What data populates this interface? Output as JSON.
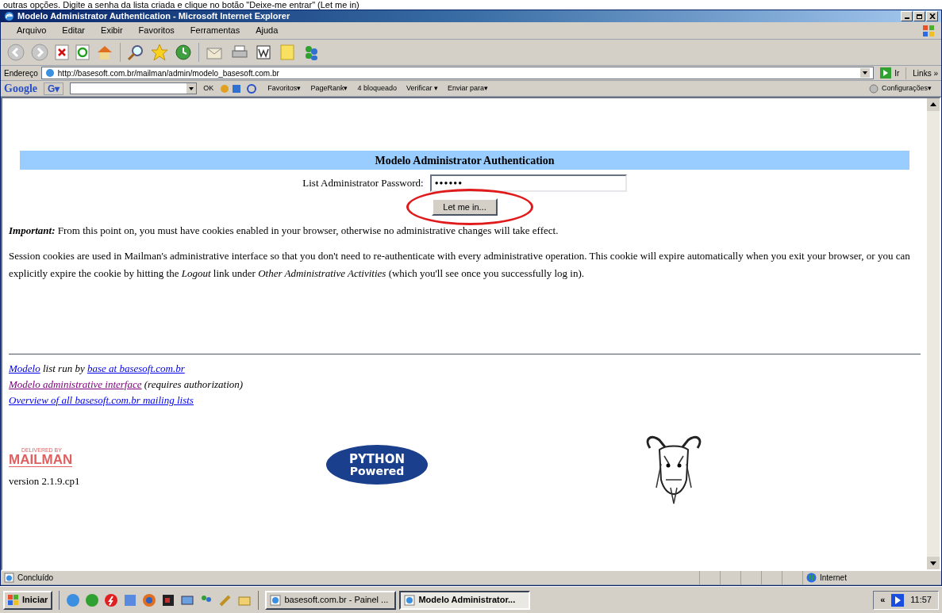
{
  "caption": "outras opções. Digite a senha da lista criada e clique no botão \"Deixe-me entrar\" (Let me in)",
  "window": {
    "title": "Modelo Administrator Authentication - Microsoft Internet Explorer"
  },
  "menu": [
    "Arquivo",
    "Editar",
    "Exibir",
    "Favoritos",
    "Ferramentas",
    "Ajuda"
  ],
  "address_bar": {
    "label": "Endereço",
    "value": "http://basesoft.com.br/mailman/admin/modelo_basesoft.com.br",
    "go": "Ir",
    "links": "Links »"
  },
  "google_bar": {
    "logo": "Google",
    "g_menu": "G▾",
    "ok": "OK",
    "items": [
      "Favoritos▾",
      "PageRank▾",
      "4 bloqueado",
      "Verificar ▾",
      "Enviar para▾"
    ],
    "settings": "Configurações▾"
  },
  "page": {
    "heading": "Modelo Administrator Authentication",
    "password_label": "List Administrator Password:",
    "password_value": "••••••",
    "submit": "Let me in...",
    "annotated": true,
    "paragraphs": [
      {
        "lead": "Important:",
        "text": " From this point on, you must have cookies enabled in your browser, otherwise no administrative changes will take effect."
      },
      {
        "text": "Session cookies are used in Mailman's administrative interface so that you don't need to re-authenticate with every administrative operation. This cookie will expire automatically when you exit your browser, or you can explicitly expire the cookie by hitting the *Logout* link under *Other Administrative Activities* (which you'll see once you successfully log in)."
      }
    ],
    "footer_lines": [
      {
        "parts": [
          {
            "text": "Modelo",
            "link": true,
            "visited": false
          },
          {
            "text": " list run by ",
            "link": false
          },
          {
            "text": "base at basesoft.com.br",
            "link": true,
            "visited": false
          }
        ]
      },
      {
        "parts": [
          {
            "text": "Modelo administrative interface",
            "link": true,
            "visited": true
          },
          {
            "text": " (requires authorization)",
            "link": false
          }
        ]
      },
      {
        "parts": [
          {
            "text": "Overview of all basesoft.com.br mailing lists",
            "link": true,
            "visited": false
          }
        ]
      }
    ],
    "mailman_logo": "MAILMAN",
    "mailman_small": "DELIVERED BY",
    "version": "version 2.1.9.cp1",
    "python_logo": [
      "PYTHON",
      "Powered"
    ]
  },
  "status_bar": {
    "text": "Concluído",
    "zone": "Internet"
  },
  "taskbar": {
    "start": "Iniciar",
    "tasks": [
      {
        "label": "basesoft.com.br - Painel ...",
        "selected": false
      },
      {
        "label": "Modelo Administrator...",
        "selected": true
      }
    ],
    "tray_toggle": "«",
    "clock": "11:57"
  }
}
